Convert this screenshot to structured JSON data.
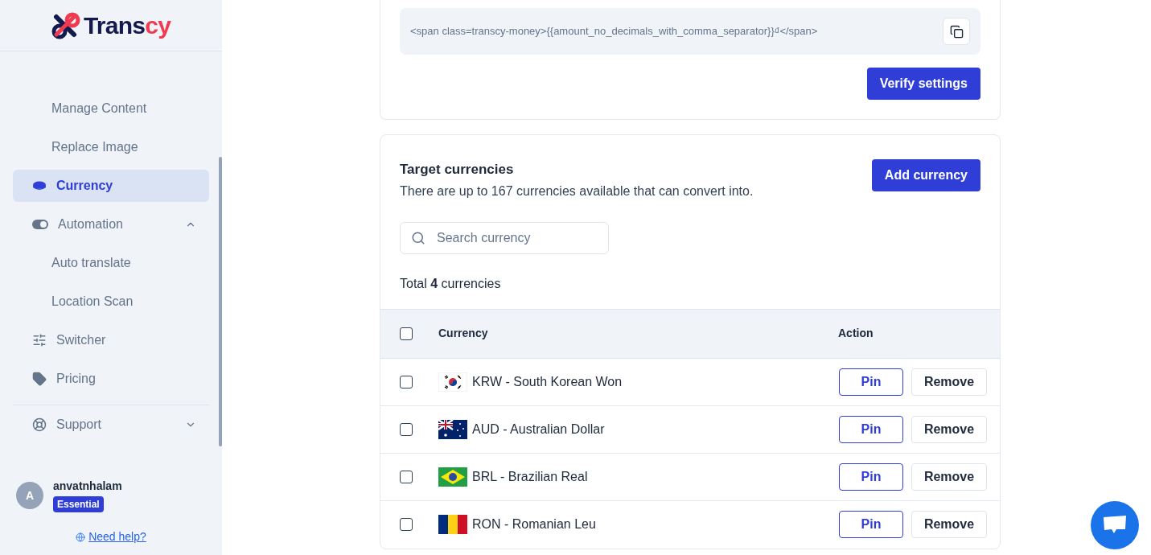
{
  "logo": {
    "text_main": "Trans",
    "text_accent": "cy"
  },
  "sidebar": {
    "items": [
      {
        "kind": "sub",
        "label": "Manage Content",
        "selected": false
      },
      {
        "kind": "sub",
        "label": "Replace Image",
        "selected": false
      },
      {
        "kind": "item",
        "label": "Currency",
        "selected": true
      },
      {
        "kind": "group",
        "label": "Automation",
        "selected": false,
        "expanded": true
      },
      {
        "kind": "sub",
        "label": "Auto translate",
        "selected": false
      },
      {
        "kind": "sub",
        "label": "Location Scan",
        "selected": false
      },
      {
        "kind": "item",
        "label": "Switcher",
        "selected": false
      },
      {
        "kind": "item",
        "label": "Pricing",
        "selected": false
      },
      {
        "kind": "divider"
      },
      {
        "kind": "group",
        "label": "Support",
        "selected": false,
        "expanded": false
      }
    ],
    "user": {
      "name": "anvatnhalam",
      "avatar_letter": "A",
      "plan": "Essential"
    },
    "help_link": "Need help?"
  },
  "format_card": {
    "code": "<span class=transcy-money>{{amount_no_decimals_with_comma_separator}}₫</span>",
    "verify_button": "Verify settings"
  },
  "currencies_card": {
    "title": "Target currencies",
    "subtitle": "There are up to 167 currencies available that can convert into.",
    "add_button": "Add currency",
    "search": {
      "placeholder": "Search currency"
    },
    "total": "Total **4** currencies",
    "table": {
      "columns": [
        "Currency",
        "Action"
      ],
      "select_all_checked": false,
      "rows": [
        {
          "label": "KRW - South Korean Won",
          "checked": false,
          "pin": "Pin",
          "remove": "Remove"
        },
        {
          "label": "AUD - Australian Dollar",
          "checked": false,
          "pin": "Pin",
          "remove": "Remove"
        },
        {
          "label": "BRL - Brazilian Real",
          "checked": false,
          "pin": "Pin",
          "remove": "Remove"
        },
        {
          "label": "RON - Romanian Leu",
          "checked": false,
          "pin": "Pin",
          "remove": "Remove"
        }
      ]
    }
  }
}
